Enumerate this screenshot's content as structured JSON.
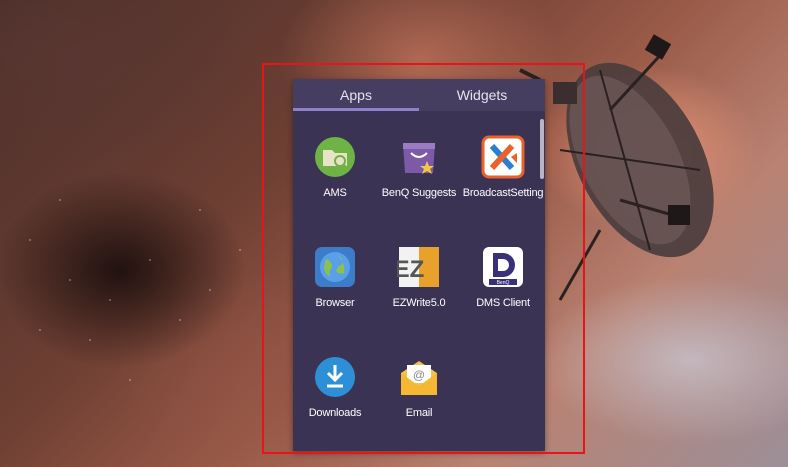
{
  "tabs": [
    {
      "label": "Apps",
      "selected": true
    },
    {
      "label": "Widgets",
      "selected": false
    }
  ],
  "apps": [
    {
      "label": "AMS",
      "icon": "ams-icon"
    },
    {
      "label": "BenQ Suggests",
      "icon": "benq-suggests-icon"
    },
    {
      "label": "BroadcastSetting",
      "icon": "broadcast-setting-icon"
    },
    {
      "label": "Browser",
      "icon": "browser-icon"
    },
    {
      "label": "EZWrite5.0",
      "icon": "ezwrite-icon"
    },
    {
      "label": "DMS Client",
      "icon": "dms-client-icon"
    },
    {
      "label": "Downloads",
      "icon": "downloads-icon"
    },
    {
      "label": "Email",
      "icon": "email-icon"
    }
  ],
  "icon_text": {
    "ezwrite_letters": "EZ",
    "dms_brand": "BenQ"
  },
  "colors": {
    "drawer_bg": "#3b3354",
    "tab_bar_bg": "#463e61",
    "tab_indicator": "#8f80c9",
    "highlight_border": "#e8141b"
  }
}
